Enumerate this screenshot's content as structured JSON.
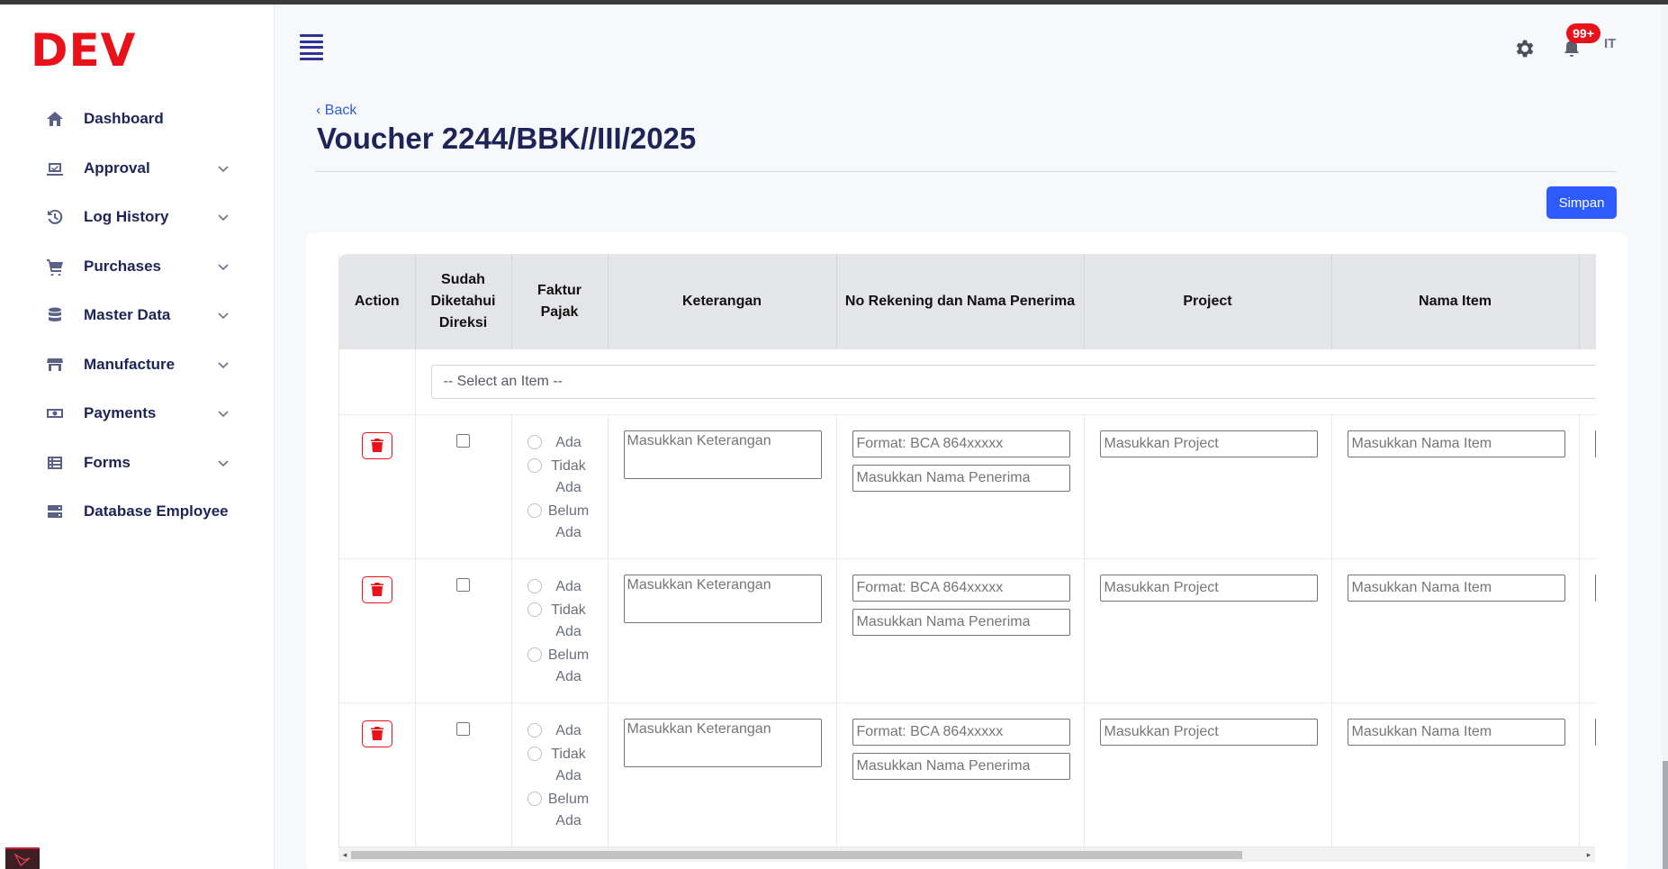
{
  "app": {
    "brand": "DEV"
  },
  "sidebar": {
    "items": [
      {
        "label": "Dashboard",
        "icon": "home-icon",
        "expandable": false
      },
      {
        "label": "Approval",
        "icon": "approval-icon",
        "expandable": true
      },
      {
        "label": "Log History",
        "icon": "history-icon",
        "expandable": true
      },
      {
        "label": "Purchases",
        "icon": "cart-icon",
        "expandable": true
      },
      {
        "label": "Master Data",
        "icon": "database-icon",
        "expandable": true
      },
      {
        "label": "Manufacture",
        "icon": "store-icon",
        "expandable": true
      },
      {
        "label": "Payments",
        "icon": "money-icon",
        "expandable": true
      },
      {
        "label": "Forms",
        "icon": "table-icon",
        "expandable": true
      },
      {
        "label": "Database Employee",
        "icon": "server-icon",
        "expandable": false
      }
    ]
  },
  "topbar": {
    "notification_count": "99+",
    "avatar_initials": "IT"
  },
  "page": {
    "back_label": "Back",
    "title": "Voucher 2244/BBK//III/2025",
    "save_label": "Simpan"
  },
  "table": {
    "headers": {
      "action": "Action",
      "sudah_diketahui": "Sudah Diketahui Direksi",
      "faktur_pajak": "Faktur Pajak",
      "keterangan": "Keterangan",
      "rekening": "No Rekening dan Nama Penerima",
      "project": "Project",
      "nama_item": "Nama Item"
    },
    "select_placeholder": "-- Select an Item --",
    "radio_options": [
      "Ada",
      "Tidak Ada",
      "Belum Ada"
    ],
    "placeholders": {
      "keterangan": "Masukkan Keterangan",
      "rekening": "Format: BCA 864xxxxx",
      "penerima": "Masukkan Nama Penerima",
      "project": "Masukkan Project",
      "nama_item": "Masukkan Nama Item"
    },
    "row_count": 3
  },
  "colors": {
    "brand_red": "#e8121b",
    "primary_blue": "#2d5bff",
    "nav_text": "#1e2458"
  }
}
